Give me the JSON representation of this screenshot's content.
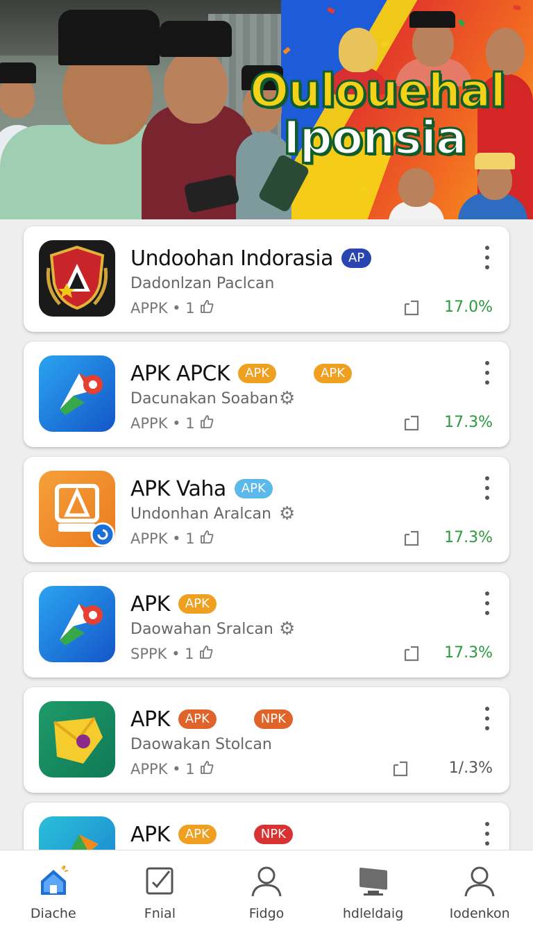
{
  "banner": {
    "title_line1": "Oulouehal",
    "title_line2": "Iponsia"
  },
  "apps": [
    {
      "title": "Undoohan Indorasia",
      "badges": [
        {
          "text": "AP",
          "color": "#2a44b0"
        }
      ],
      "subtitle": "Dadonlzan Paclcan",
      "show_gear": false,
      "meta": "APPK • 1",
      "percent": "17.0%",
      "percent_color": "#2a9a3c",
      "icon": "shield-emblem-icon"
    },
    {
      "title": "APK APCK",
      "badges": [
        {
          "text": "APK",
          "color": "#f0a020"
        },
        {
          "text": "APK",
          "color": "#f0a020"
        }
      ],
      "subtitle": "Dacunakan Soaban",
      "show_gear": true,
      "meta": "APPK • 1",
      "percent": "17.3%",
      "percent_color": "#2a9a3c",
      "icon": "blue-arrow-logo-icon"
    },
    {
      "title": "APK Vaha",
      "badges": [
        {
          "text": "APK",
          "color": "#5ab8ea"
        }
      ],
      "subtitle": "Undonhan Aralcan",
      "show_gear": true,
      "meta": "APPK • 1",
      "percent": "17.3%",
      "percent_color": "#2a9a3c",
      "icon": "orange-frame-icon"
    },
    {
      "title": "APK",
      "badges": [
        {
          "text": "APK",
          "color": "#f0a020"
        }
      ],
      "subtitle": "Daowahan Sralcan",
      "show_gear": true,
      "meta": "SPPK • 1",
      "percent": "17.3%",
      "percent_color": "#2a9a3c",
      "icon": "blue-arrow-logo-icon"
    },
    {
      "title": "APK",
      "badges": [
        {
          "text": "APK",
          "color": "#e0632a"
        },
        {
          "text": "NPK",
          "color": "#e0632a"
        }
      ],
      "subtitle": "Daowakan Stolcan",
      "show_gear": false,
      "meta": "APPK • 1",
      "percent": "1/.3%",
      "percent_color": "#555555",
      "icon": "green-folder-icon"
    },
    {
      "title": "APK",
      "badges": [
        {
          "text": "APK",
          "color": "#f0a020"
        },
        {
          "text": "NPK",
          "color": "#d83232"
        }
      ],
      "subtitle": "",
      "show_gear": false,
      "meta": "",
      "percent": "",
      "percent_color": "#2a9a3c",
      "icon": "teal-arrow-logo-icon"
    }
  ],
  "nav": [
    {
      "label": "Diache",
      "icon": "home-icon",
      "active": true
    },
    {
      "label": "Fnial",
      "icon": "edit-square-icon",
      "active": false
    },
    {
      "label": "Fidgo",
      "icon": "person-icon",
      "active": false
    },
    {
      "label": "hdleldaig",
      "icon": "monitor-icon",
      "active": false
    },
    {
      "label": "Iodenkon",
      "icon": "profile-icon",
      "active": false
    }
  ],
  "colors": {
    "accent_blue": "#1f6fd6",
    "percent_green": "#2a9a3c",
    "banner_title_yellow": "#f4d21a",
    "banner_title_outline": "#0f5d2a"
  }
}
